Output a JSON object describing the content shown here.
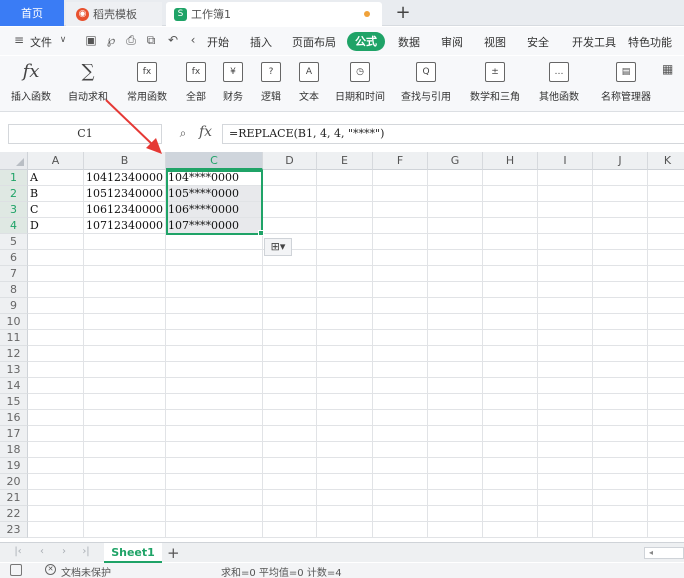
{
  "tabs": {
    "home": "首页",
    "template": "稻壳模板",
    "workbook": "工作簿1",
    "new_tab": "+"
  },
  "menu": {
    "file": "文件",
    "items": [
      "开始",
      "插入",
      "页面布局",
      "公式",
      "数据",
      "审阅",
      "视图",
      "安全",
      "开发工具",
      "特色功能"
    ],
    "active": "公式"
  },
  "ribbon": {
    "buttons": [
      {
        "label": "插入函数",
        "icon": "fx"
      },
      {
        "label": "自动求和",
        "icon": "∑"
      },
      {
        "label": "常用函数",
        "icon": "fx"
      },
      {
        "label": "全部",
        "icon": "fx"
      },
      {
        "label": "财务",
        "icon": "¥"
      },
      {
        "label": "逻辑",
        "icon": "?"
      },
      {
        "label": "文本",
        "icon": "A"
      },
      {
        "label": "日期和时间",
        "icon": "◷"
      },
      {
        "label": "查找与引用",
        "icon": "Q"
      },
      {
        "label": "数学和三角",
        "icon": "±"
      },
      {
        "label": "其他函数",
        "icon": "…"
      },
      {
        "label": "名称管理器",
        "icon": "▤"
      }
    ]
  },
  "formula_bar": {
    "cell_ref": "C1",
    "fx": "fx",
    "formula": "=REPLACE(B1, 4, 4, \"****\")"
  },
  "grid": {
    "columns": [
      "A",
      "B",
      "C",
      "D",
      "E",
      "F",
      "G",
      "H",
      "I",
      "J",
      "K"
    ],
    "rows": [
      "1",
      "2",
      "3",
      "4",
      "5",
      "6",
      "7",
      "8",
      "9",
      "10",
      "11",
      "12",
      "13",
      "14",
      "15",
      "16",
      "17",
      "18",
      "19",
      "20",
      "21",
      "22",
      "23"
    ],
    "data": [
      {
        "a": "A",
        "b": "10412340000",
        "c": "104****0000"
      },
      {
        "a": "B",
        "b": "10512340000",
        "c": "105****0000"
      },
      {
        "a": "C",
        "b": "10612340000",
        "c": "106****0000"
      },
      {
        "a": "D",
        "b": "10712340000",
        "c": "107****0000"
      }
    ]
  },
  "sheets": {
    "active": "Sheet1",
    "add": "+"
  },
  "status": {
    "protect": "文档未保护",
    "stats": "求和=0  平均值=0  计数=4"
  },
  "colors": {
    "accent": "#1fa367",
    "home_tab": "#3a7cf5",
    "arrow": "#e53935"
  }
}
